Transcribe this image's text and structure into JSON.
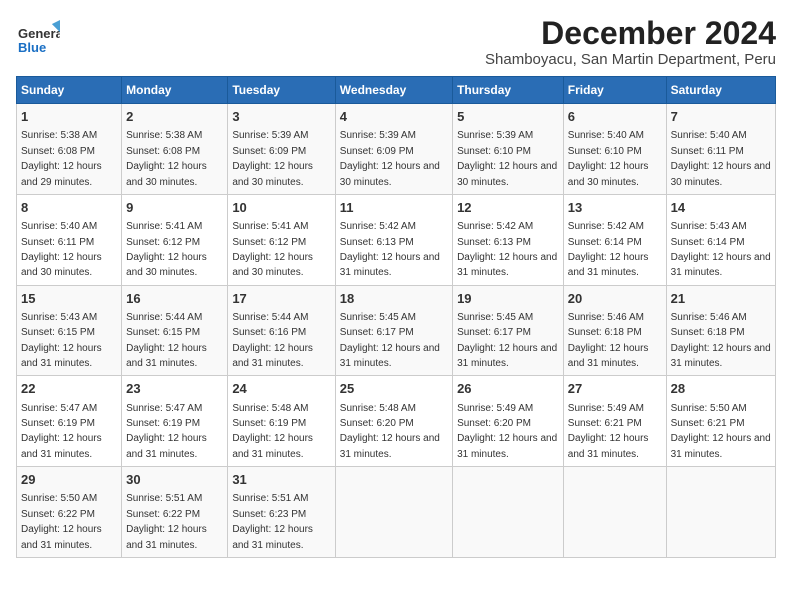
{
  "logo": {
    "line1": "General",
    "line2": "Blue"
  },
  "title": "December 2024",
  "subtitle": "Shamboyacu, San Martin Department, Peru",
  "days_of_week": [
    "Sunday",
    "Monday",
    "Tuesday",
    "Wednesday",
    "Thursday",
    "Friday",
    "Saturday"
  ],
  "weeks": [
    [
      {
        "day": "1",
        "sunrise": "5:38 AM",
        "sunset": "6:08 PM",
        "daylight": "12 hours and 29 minutes."
      },
      {
        "day": "2",
        "sunrise": "5:38 AM",
        "sunset": "6:08 PM",
        "daylight": "12 hours and 30 minutes."
      },
      {
        "day": "3",
        "sunrise": "5:39 AM",
        "sunset": "6:09 PM",
        "daylight": "12 hours and 30 minutes."
      },
      {
        "day": "4",
        "sunrise": "5:39 AM",
        "sunset": "6:09 PM",
        "daylight": "12 hours and 30 minutes."
      },
      {
        "day": "5",
        "sunrise": "5:39 AM",
        "sunset": "6:10 PM",
        "daylight": "12 hours and 30 minutes."
      },
      {
        "day": "6",
        "sunrise": "5:40 AM",
        "sunset": "6:10 PM",
        "daylight": "12 hours and 30 minutes."
      },
      {
        "day": "7",
        "sunrise": "5:40 AM",
        "sunset": "6:11 PM",
        "daylight": "12 hours and 30 minutes."
      }
    ],
    [
      {
        "day": "8",
        "sunrise": "5:40 AM",
        "sunset": "6:11 PM",
        "daylight": "12 hours and 30 minutes."
      },
      {
        "day": "9",
        "sunrise": "5:41 AM",
        "sunset": "6:12 PM",
        "daylight": "12 hours and 30 minutes."
      },
      {
        "day": "10",
        "sunrise": "5:41 AM",
        "sunset": "6:12 PM",
        "daylight": "12 hours and 30 minutes."
      },
      {
        "day": "11",
        "sunrise": "5:42 AM",
        "sunset": "6:13 PM",
        "daylight": "12 hours and 31 minutes."
      },
      {
        "day": "12",
        "sunrise": "5:42 AM",
        "sunset": "6:13 PM",
        "daylight": "12 hours and 31 minutes."
      },
      {
        "day": "13",
        "sunrise": "5:42 AM",
        "sunset": "6:14 PM",
        "daylight": "12 hours and 31 minutes."
      },
      {
        "day": "14",
        "sunrise": "5:43 AM",
        "sunset": "6:14 PM",
        "daylight": "12 hours and 31 minutes."
      }
    ],
    [
      {
        "day": "15",
        "sunrise": "5:43 AM",
        "sunset": "6:15 PM",
        "daylight": "12 hours and 31 minutes."
      },
      {
        "day": "16",
        "sunrise": "5:44 AM",
        "sunset": "6:15 PM",
        "daylight": "12 hours and 31 minutes."
      },
      {
        "day": "17",
        "sunrise": "5:44 AM",
        "sunset": "6:16 PM",
        "daylight": "12 hours and 31 minutes."
      },
      {
        "day": "18",
        "sunrise": "5:45 AM",
        "sunset": "6:17 PM",
        "daylight": "12 hours and 31 minutes."
      },
      {
        "day": "19",
        "sunrise": "5:45 AM",
        "sunset": "6:17 PM",
        "daylight": "12 hours and 31 minutes."
      },
      {
        "day": "20",
        "sunrise": "5:46 AM",
        "sunset": "6:18 PM",
        "daylight": "12 hours and 31 minutes."
      },
      {
        "day": "21",
        "sunrise": "5:46 AM",
        "sunset": "6:18 PM",
        "daylight": "12 hours and 31 minutes."
      }
    ],
    [
      {
        "day": "22",
        "sunrise": "5:47 AM",
        "sunset": "6:19 PM",
        "daylight": "12 hours and 31 minutes."
      },
      {
        "day": "23",
        "sunrise": "5:47 AM",
        "sunset": "6:19 PM",
        "daylight": "12 hours and 31 minutes."
      },
      {
        "day": "24",
        "sunrise": "5:48 AM",
        "sunset": "6:19 PM",
        "daylight": "12 hours and 31 minutes."
      },
      {
        "day": "25",
        "sunrise": "5:48 AM",
        "sunset": "6:20 PM",
        "daylight": "12 hours and 31 minutes."
      },
      {
        "day": "26",
        "sunrise": "5:49 AM",
        "sunset": "6:20 PM",
        "daylight": "12 hours and 31 minutes."
      },
      {
        "day": "27",
        "sunrise": "5:49 AM",
        "sunset": "6:21 PM",
        "daylight": "12 hours and 31 minutes."
      },
      {
        "day": "28",
        "sunrise": "5:50 AM",
        "sunset": "6:21 PM",
        "daylight": "12 hours and 31 minutes."
      }
    ],
    [
      {
        "day": "29",
        "sunrise": "5:50 AM",
        "sunset": "6:22 PM",
        "daylight": "12 hours and 31 minutes."
      },
      {
        "day": "30",
        "sunrise": "5:51 AM",
        "sunset": "6:22 PM",
        "daylight": "12 hours and 31 minutes."
      },
      {
        "day": "31",
        "sunrise": "5:51 AM",
        "sunset": "6:23 PM",
        "daylight": "12 hours and 31 minutes."
      },
      null,
      null,
      null,
      null
    ]
  ]
}
